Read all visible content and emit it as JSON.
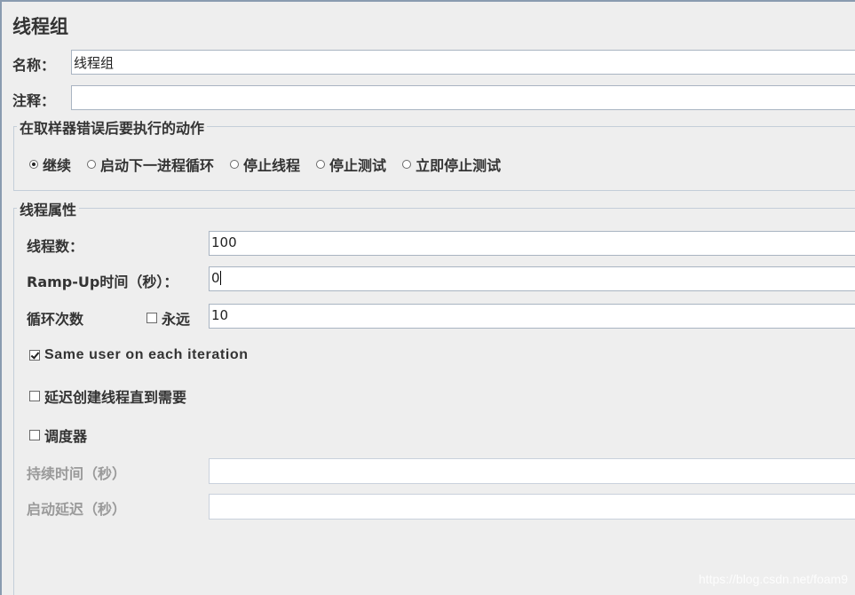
{
  "title": "线程组",
  "name_field": {
    "label": "名称：",
    "value": "线程组"
  },
  "comment_field": {
    "label": "注释：",
    "value": ""
  },
  "sampler_error_group": {
    "legend": "在取样器错误后要执行的动作",
    "options": [
      {
        "label": "继续",
        "selected": true
      },
      {
        "label": "启动下一进程循环",
        "selected": false
      },
      {
        "label": "停止线程",
        "selected": false
      },
      {
        "label": "停止测试",
        "selected": false
      },
      {
        "label": "立即停止测试",
        "selected": false
      }
    ]
  },
  "thread_props": {
    "legend": "线程属性",
    "threads_label": "线程数：",
    "threads_value": "100",
    "rampup_label": "Ramp-Up时间（秒）：",
    "rampup_value": "0",
    "loop_label": "循环次数",
    "forever_label": "永远",
    "forever_checked": false,
    "loop_value": "10",
    "same_user_label": "Same user on each iteration",
    "same_user_checked": true,
    "delay_create_label": "延迟创建线程直到需要",
    "delay_create_checked": false,
    "scheduler_label": "调度器",
    "scheduler_checked": false,
    "duration_label": "持续时间（秒）",
    "duration_value": "",
    "startup_delay_label": "启动延迟（秒）",
    "startup_delay_value": ""
  },
  "watermark": "https://blog.csdn.net/foam9"
}
